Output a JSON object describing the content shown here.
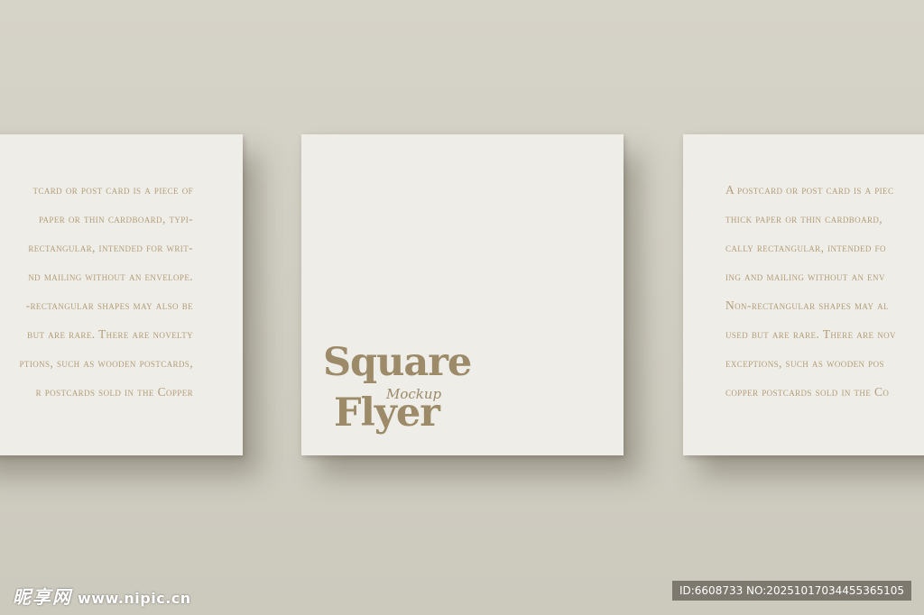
{
  "left_card": {
    "lines": [
      "tcard or post card is a piece of",
      "paper or thin cardboard, typi-",
      "rectangular, intended for writ-",
      "nd mailing without an envelope.",
      "-rectangular shapes may also be",
      "but are rare. There are novelty",
      "ptions, such as wooden postcards,",
      "r postcards sold in the Copper"
    ]
  },
  "center_card": {
    "title_line1": "Square",
    "title_sub": "Mockup",
    "title_line2": "Flyer"
  },
  "right_card": {
    "lines": [
      "A postcard or post card is a piec",
      "thick paper or thin cardboard,",
      "cally rectangular, intended fo",
      "ing and mailing without an env",
      "Non-rectangular shapes may al",
      "used but are rare. There are nov",
      "exceptions, such as wooden pos",
      "copper postcards sold in the Co"
    ]
  },
  "watermark": {
    "brand": "昵享网",
    "site": "www.nipic.cn",
    "id_text": "ID:6608733 NO:20251017034455365105"
  },
  "colors": {
    "background": "#d2cfc4",
    "card": "#eeede8",
    "accent_text": "#b39d78",
    "title": "#9c8a68"
  }
}
